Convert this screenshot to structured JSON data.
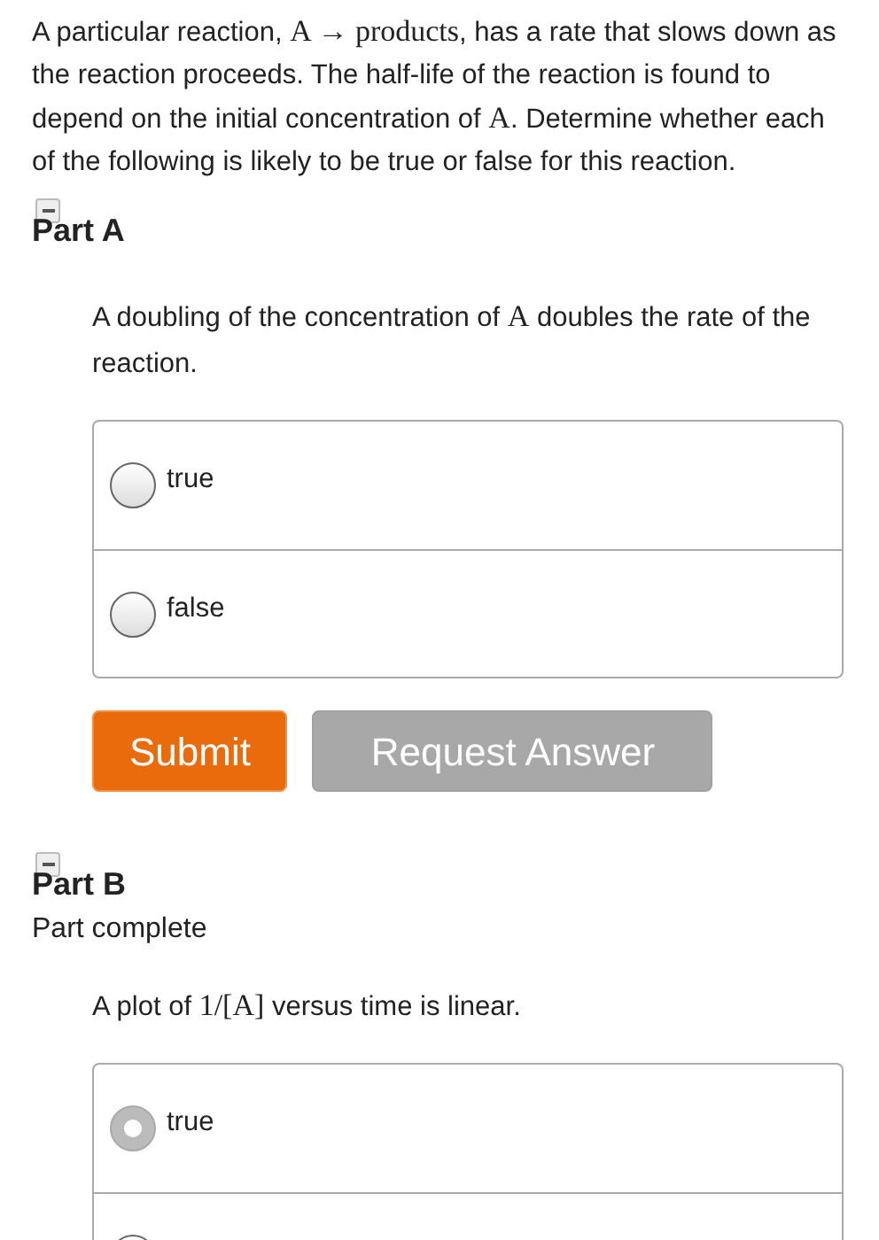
{
  "intro": [
    {
      "kind": "text",
      "text": "A particular reaction, "
    },
    {
      "kind": "math",
      "text": "A → products"
    },
    {
      "kind": "text",
      "text": ", has a rate that slows down as the reaction proceeds. The half-life of the reaction is found to depend on the initial concentration of "
    },
    {
      "kind": "math",
      "text": "A"
    },
    {
      "kind": "text",
      "text": ". Determine whether each of the following is likely to be true or false for this reaction."
    }
  ],
  "parts": [
    {
      "title": "Part A",
      "expanded": true,
      "question": [
        {
          "kind": "text",
          "text": "A doubling of the concentration of "
        },
        {
          "kind": "math",
          "text": "A"
        },
        {
          "kind": "text",
          "text": " doubles the rate of the reaction."
        }
      ],
      "options": [
        {
          "label": "true",
          "selected": false
        },
        {
          "label": "false",
          "selected": false
        }
      ],
      "buttons": [
        {
          "label": "Submit",
          "disabled": false
        },
        {
          "label": "Request Answer",
          "disabled": true
        }
      ]
    },
    {
      "title": "Part B",
      "expanded": true,
      "status": "Part complete",
      "question": [
        {
          "kind": "text",
          "text": "A plot of "
        },
        {
          "kind": "math",
          "text": "1/[A]"
        },
        {
          "kind": "text",
          "text": " versus time is linear."
        }
      ],
      "options": [
        {
          "label": "true",
          "selected": true
        },
        {
          "selected": false
        }
      ]
    }
  ]
}
